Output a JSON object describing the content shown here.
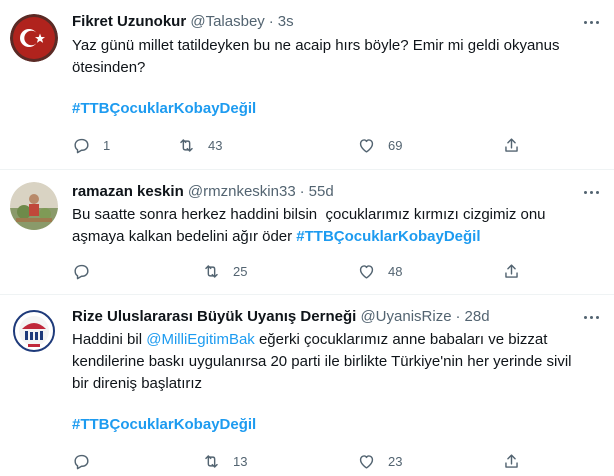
{
  "tweets": [
    {
      "name": "Fikret Uzunokur",
      "handle": "@Talasbey",
      "separator": "·",
      "time": "3s",
      "text_line1": "Yaz günü millet tatildeyken bu ne acaip hırs böyle? Emir mi geldi okyanus",
      "text_line2": "ötesinden?",
      "hashtag": "#TTBÇocuklarKobayDeğil",
      "replies": "1",
      "retweets": "43",
      "likes": "69",
      "avatar_icon": "turkish-flag-avatar"
    },
    {
      "name": "ramazan keskin",
      "handle": "@rmznkeskin33",
      "separator": "·",
      "time": "55d",
      "text_line1": "Bu saatte sonra herkez haddini bilsin  çocuklarımız kırmızı cizgimiz onu",
      "text_line2_prefix": "aşmaya kalkan bedelini ağır öder ",
      "hashtag": "#TTBÇocuklarKobayDeğil",
      "replies": "",
      "retweets": "25",
      "likes": "48",
      "avatar_icon": "photo-avatar"
    },
    {
      "name": "Rize Uluslararası Büyük Uyanış Derneği",
      "handle": "@UyanisRize",
      "separator": "·",
      "time": "28d",
      "text_line1_prefix": "Haddini bil ",
      "mention": "@MilliEgitimBak",
      "text_line1_suffix": " eğerki çocuklarımız anne babaları ve bizzat",
      "text_line2": "kendilerine baskı uygulanırsa 20 parti ile birlikte Türkiye'nin her yerinde sivil",
      "text_line3": "bir direniş başlatırız",
      "hashtag": "#TTBÇocuklarKobayDeğil",
      "replies": "",
      "retweets": "13",
      "likes": "23",
      "avatar_icon": "association-logo-avatar"
    }
  ],
  "colors": {
    "accent": "#1d9bf0",
    "secondary_text": "#536471",
    "primary_text": "#0f1419",
    "divider": "#eff3f4"
  }
}
